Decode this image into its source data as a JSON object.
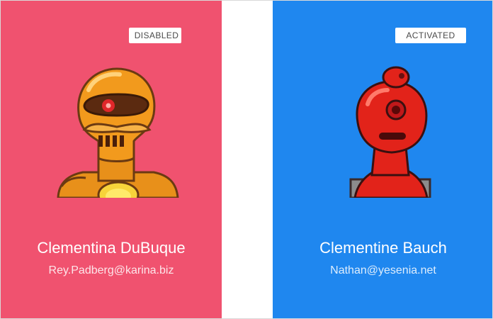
{
  "cards": [
    {
      "status": "DISABLED",
      "name": "Clementina DuBuque",
      "email": "Rey.Padberg@karina.biz",
      "background": "#f0526f",
      "avatar_icon": "orange-robot-avatar"
    },
    {
      "status": "ACTIVATED",
      "name": "Clementine Bauch",
      "email": "Nathan@yesenia.net",
      "background": "#1f87ef",
      "avatar_icon": "red-robot-avatar"
    }
  ]
}
